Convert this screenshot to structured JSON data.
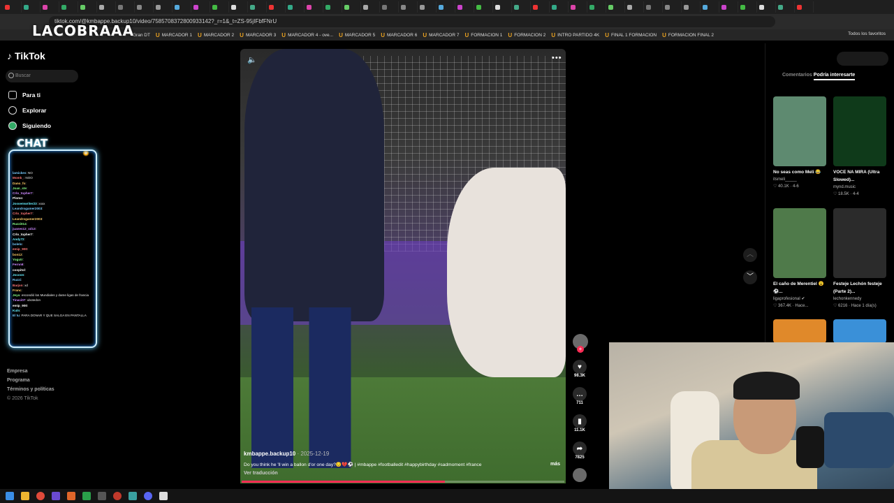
{
  "browser": {
    "url": "tiktok.com/@kmbappe.backup10/video/7585708372800933142?_r=1&_t=ZS-95jIFbfFNrU",
    "bookmarks": [
      "Gran DT",
      "MARCADOR 1",
      "MARCADOR 2",
      "MARCADOR 3",
      "MARCADOR 4 - ove...",
      "MARCADOR 5",
      "MARCADOR 6",
      "MARCADOR 7",
      "FORMACION 1",
      "FORMACION 2",
      "INTRO PARTIDO 4K",
      "FINAL 1 FORMACION",
      "FORMACION FINAL 2"
    ],
    "all_favorites": "Todos los favoritos"
  },
  "overlay": {
    "streamer_name": "LACOBRAAA",
    "chat_title": "CHAT"
  },
  "sidebar": {
    "logo": "TikTok",
    "search_placeholder": "Buscar",
    "nav": [
      "Para ti",
      "Explorar",
      "Siguiendo"
    ],
    "footer": [
      "Empresa",
      "Programa",
      "Términos y políticas",
      "© 2026 TikTok"
    ]
  },
  "chat": {
    "messages": [
      {
        "user": "lamickes",
        "text": ": NO"
      },
      {
        "user": "Momk_",
        "text": ": NOO"
      },
      {
        "user": "Dano_fo",
        "text": ": "
      },
      {
        "user": "Joan_ste",
        "text": ": "
      },
      {
        "user": "Crlo_topher7",
        "text": ": "
      },
      {
        "user": "Plomo",
        "text": ": "
      },
      {
        "user": "Jossemwriter23",
        "text": ": xxxx"
      },
      {
        "user": "Leandrogamer2003",
        "text": ": "
      },
      {
        "user": "Crlo_topher7",
        "text": ": "
      },
      {
        "user": "Leandrogamer2003",
        "text": ": "
      },
      {
        "user": "Ruzzi014",
        "text": ": "
      },
      {
        "user": "juanes12_xd13",
        "text": ": "
      },
      {
        "user": "Crlo_topher7",
        "text": ": "
      },
      {
        "user": "Andy72",
        "text": ": "
      },
      {
        "user": "bolelo",
        "text": ": "
      },
      {
        "user": "emip_900",
        "text": ": "
      },
      {
        "user": "bon12",
        "text": ": "
      },
      {
        "user": "Yogutr",
        "text": ": "
      },
      {
        "user": "Fernn9",
        "text": ": "
      },
      {
        "user": "coopitol",
        "text": ": "
      },
      {
        "user": "Jocoon",
        "text": ": "
      },
      {
        "user": "Ruzzi",
        "text": ": "
      },
      {
        "user": "Barjon",
        "text": ": xd"
      },
      {
        "user": "Franc",
        "text": ": "
      },
      {
        "user": "Jeya",
        "text": ": escondió los Mundiales y dame ligas de francia"
      },
      {
        "user": "Tinaci07",
        "text": ": ubotedon"
      },
      {
        "user": "emip_900",
        "text": ": "
      },
      {
        "user": "Kuln",
        "text": ": "
      },
      {
        "user": "El tu",
        "text": ": PARA DONAR Y QUE SALGA EN PANTALLA"
      }
    ]
  },
  "video": {
    "author": "kmbappe.backup10",
    "date": "· 2025-12-19",
    "caption": "Do you think he 'll win a ballon d'or one day?😔💔⚽ | #mbappe #footballedit #happybirthday #sadmoment #france",
    "more": "más",
    "translate": "Ver traducción",
    "progress": 0.63
  },
  "actions": {
    "likes": "98.3K",
    "comments": "711",
    "saves": "11.1K",
    "shares": "7825"
  },
  "right_panel": {
    "tabs": [
      "Comentarios",
      "Podría interesarte"
    ],
    "cards": [
      {
        "title": "No seas como Meli 😂",
        "user": "itsmeli_____",
        "meta": "♡ 40.1K · 4-6",
        "color": "#5e8a70"
      },
      {
        "title": "VOCE NA MIRA (Ultra Slowed)...",
        "user": "mynd.music",
        "meta": "♡ 18.5K · 4-4",
        "color": "#0f3a1a"
      },
      {
        "title": "El caño de Merentiel 😮 ⚽...",
        "user": "ligaprofesional ✔",
        "meta": "♡ 367.4K · Hace...",
        "color": "#4f7a4a"
      },
      {
        "title": "Festeje Lechón festeje (Parte 2)...",
        "user": "lechonkennedy",
        "meta": "♡ 6216 · Hace 1 día(s)",
        "color": "#2b2b2b"
      },
      {
        "title": "",
        "user": "",
        "meta": "",
        "color": "#e0892a"
      },
      {
        "title": "",
        "user": "",
        "meta": "",
        "color": "#3a90d8"
      }
    ]
  },
  "colors": {
    "accent": "#fe2c55",
    "chat_glow": "#66ccff"
  }
}
